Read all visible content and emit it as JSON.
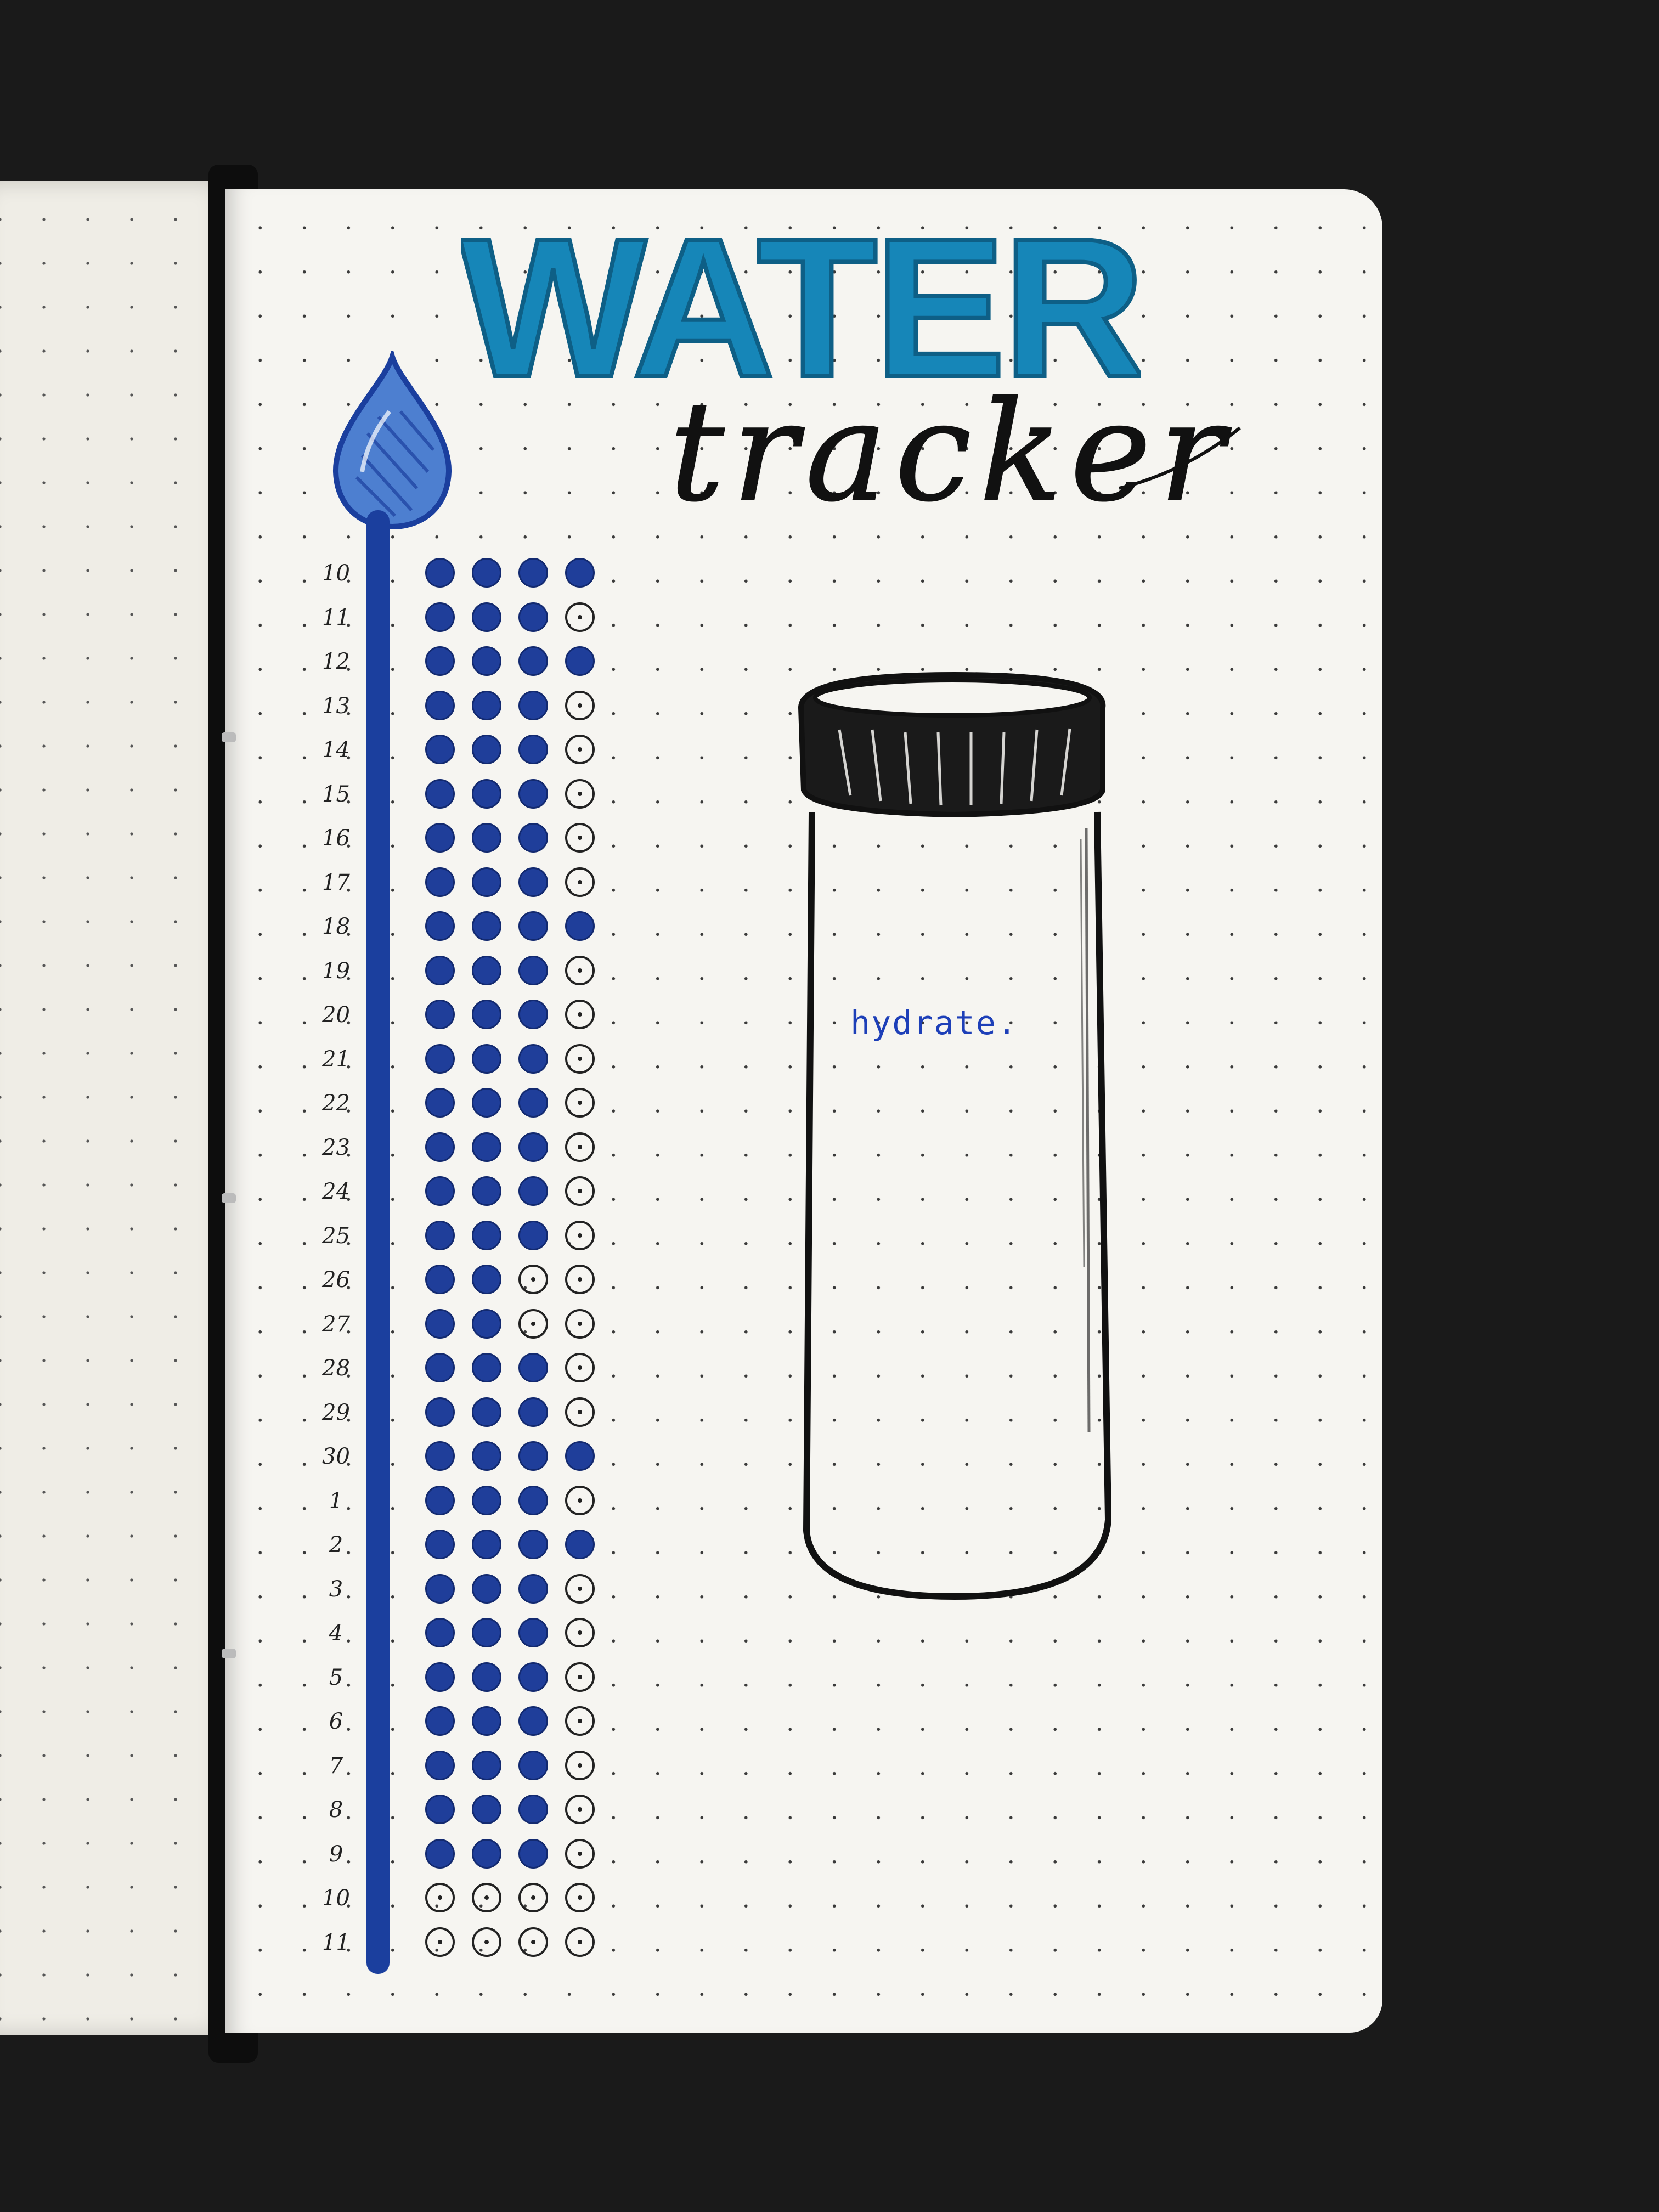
{
  "title": {
    "main": "WATER",
    "sub": "tracker"
  },
  "bottle_label": "hydrate.",
  "colors": {
    "title_teal": "#1686b8",
    "ink_blue": "#1f3e9a",
    "marker_blue": "#1b3f9e",
    "paper": "#f6f5f1",
    "ink_black": "#111111"
  },
  "tracker": {
    "columns": 4,
    "rows": [
      {
        "day": "10",
        "cups": [
          1,
          1,
          1,
          1
        ]
      },
      {
        "day": "11",
        "cups": [
          1,
          1,
          1,
          0
        ]
      },
      {
        "day": "12",
        "cups": [
          1,
          1,
          1,
          1
        ]
      },
      {
        "day": "13",
        "cups": [
          1,
          1,
          1,
          0
        ]
      },
      {
        "day": "14",
        "cups": [
          1,
          1,
          1,
          0
        ]
      },
      {
        "day": "15",
        "cups": [
          1,
          1,
          1,
          0
        ]
      },
      {
        "day": "16",
        "cups": [
          1,
          1,
          1,
          0
        ]
      },
      {
        "day": "17",
        "cups": [
          1,
          1,
          1,
          0
        ]
      },
      {
        "day": "18",
        "cups": [
          1,
          1,
          1,
          1
        ]
      },
      {
        "day": "19",
        "cups": [
          1,
          1,
          1,
          0
        ]
      },
      {
        "day": "20",
        "cups": [
          1,
          1,
          1,
          0
        ]
      },
      {
        "day": "21",
        "cups": [
          1,
          1,
          1,
          0
        ]
      },
      {
        "day": "22",
        "cups": [
          1,
          1,
          1,
          0
        ]
      },
      {
        "day": "23",
        "cups": [
          1,
          1,
          1,
          0
        ]
      },
      {
        "day": "24",
        "cups": [
          1,
          1,
          1,
          0
        ]
      },
      {
        "day": "25",
        "cups": [
          1,
          1,
          1,
          0
        ]
      },
      {
        "day": "26",
        "cups": [
          1,
          1,
          0,
          0
        ]
      },
      {
        "day": "27",
        "cups": [
          1,
          1,
          0,
          0
        ]
      },
      {
        "day": "28",
        "cups": [
          1,
          1,
          1,
          0
        ]
      },
      {
        "day": "29",
        "cups": [
          1,
          1,
          1,
          0
        ]
      },
      {
        "day": "30",
        "cups": [
          1,
          1,
          1,
          1
        ]
      },
      {
        "day": "1",
        "cups": [
          1,
          1,
          1,
          0
        ]
      },
      {
        "day": "2",
        "cups": [
          1,
          1,
          1,
          1
        ]
      },
      {
        "day": "3",
        "cups": [
          1,
          1,
          1,
          0
        ]
      },
      {
        "day": "4",
        "cups": [
          1,
          1,
          1,
          0
        ]
      },
      {
        "day": "5",
        "cups": [
          1,
          1,
          1,
          0
        ]
      },
      {
        "day": "6",
        "cups": [
          1,
          1,
          1,
          0
        ]
      },
      {
        "day": "7",
        "cups": [
          1,
          1,
          1,
          0
        ]
      },
      {
        "day": "8",
        "cups": [
          1,
          1,
          1,
          0
        ]
      },
      {
        "day": "9",
        "cups": [
          1,
          1,
          1,
          0
        ]
      },
      {
        "day": "10",
        "cups": [
          0,
          0,
          0,
          0
        ]
      },
      {
        "day": "11",
        "cups": [
          0,
          0,
          0,
          0
        ]
      }
    ]
  }
}
